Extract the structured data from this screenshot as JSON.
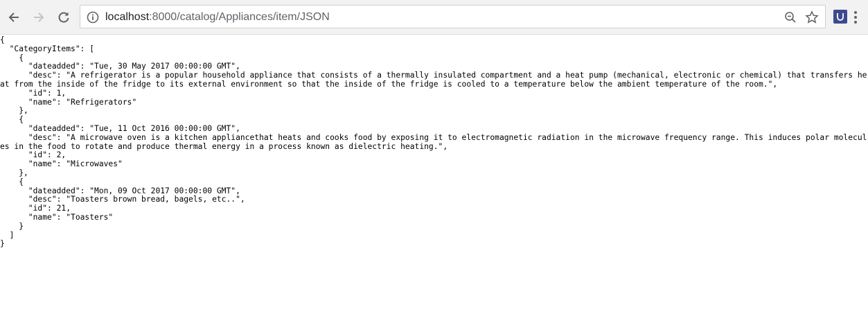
{
  "browser": {
    "url_host": "localhost",
    "url_rest": ":8000/catalog/Appliances/item/JSON",
    "icons": {
      "back": "arrow-left-icon",
      "forward": "arrow-right-icon",
      "reload": "reload-icon",
      "info": "info-icon",
      "zoom": "zoom-icon",
      "bookmark": "star-icon",
      "extension": "extension-icon",
      "menu": "kebab-menu-icon"
    }
  },
  "json_view": {
    "lines": [
      "{",
      "  \"CategoryItems\": [",
      "    {",
      "      \"dateadded\": \"Tue, 30 May 2017 00:00:00 GMT\",",
      "      \"desc\": \"A refrigerator is a popular household appliance that consists of a thermally insulated compartment and a heat pump (mechanical, electronic or chemical) that transfers heat from the inside of the fridge to its external environment so that the inside of the fridge is cooled to a temperature below the ambient temperature of the room.\",",
      "      \"id\": 1,",
      "      \"name\": \"Refrigerators\"",
      "    },",
      "    {",
      "      \"dateadded\": \"Tue, 11 Oct 2016 00:00:00 GMT\",",
      "      \"desc\": \"A microwave oven is a kitchen appliancethat heats and cooks food by exposing it to electromagnetic radiation in the microwave frequency range. This induces polar molecules in the food to rotate and produce thermal energy in a process known as dielectric heating.\",",
      "      \"id\": 2,",
      "      \"name\": \"Microwaves\"",
      "    },",
      "    {",
      "      \"dateadded\": \"Mon, 09 Oct 2017 00:00:00 GMT\",",
      "      \"desc\": \"Toasters brown bread, bagels, etc..\",",
      "      \"id\": 21,",
      "      \"name\": \"Toasters\"",
      "    }",
      "  ]",
      "}"
    ]
  }
}
